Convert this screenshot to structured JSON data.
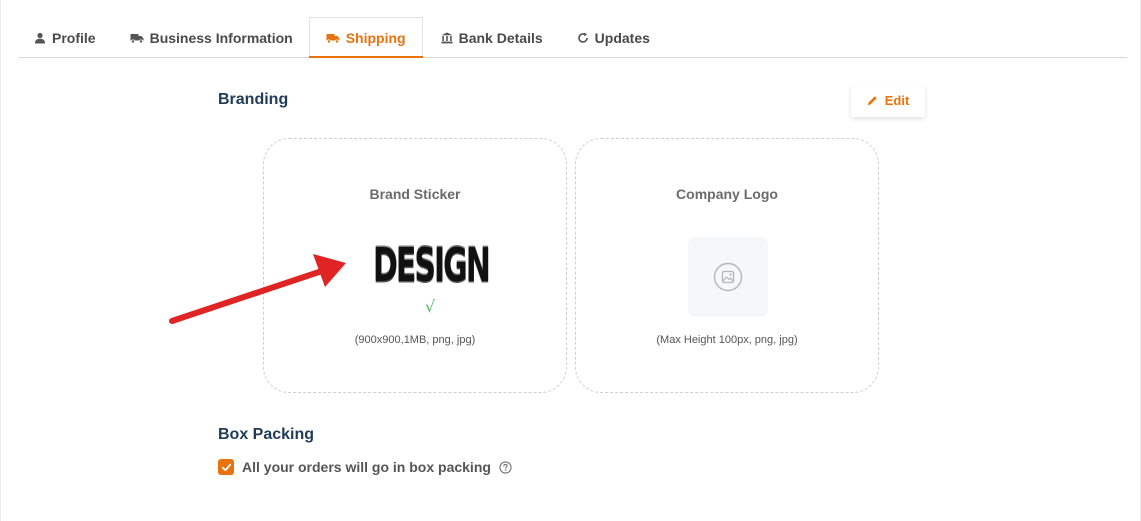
{
  "tabs": [
    {
      "label": "Profile",
      "icon": "user-icon",
      "active": false
    },
    {
      "label": "Business Information",
      "icon": "truck-icon",
      "active": false
    },
    {
      "label": "Shipping",
      "icon": "truck-icon",
      "active": true
    },
    {
      "label": "Bank Details",
      "icon": "bank-icon",
      "active": false
    },
    {
      "label": "Updates",
      "icon": "refresh-icon",
      "active": false
    }
  ],
  "branding": {
    "title": "Branding",
    "edit_label": "Edit",
    "brand_sticker": {
      "label": "Brand Sticker",
      "image_text": "DESIGN",
      "hint": "(900x900,1MB, png, jpg)"
    },
    "company_logo": {
      "label": "Company Logo",
      "hint": "(Max Height 100px, png, jpg)"
    }
  },
  "box_packing": {
    "title": "Box Packing",
    "checkbox_label": "All your orders will go in box packing",
    "checked": true
  },
  "colors": {
    "accent": "#e8730e",
    "heading": "#1f3b57",
    "annotation_arrow": "#e02424"
  }
}
